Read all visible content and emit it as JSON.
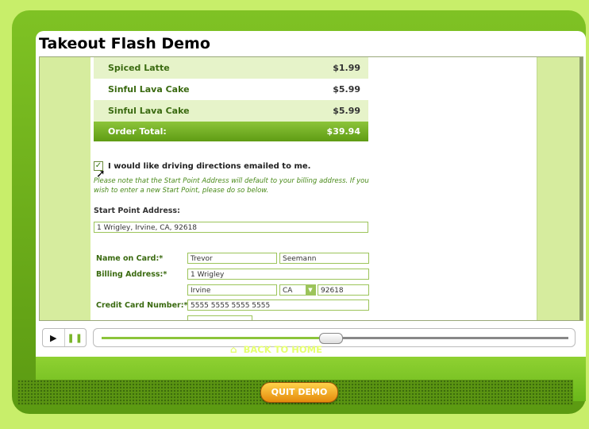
{
  "title": "Takeout Flash Demo",
  "order": {
    "rows": [
      {
        "item": "Spiced Latte",
        "price": "$1.99"
      },
      {
        "item": "Sinful Lava Cake",
        "price": "$5.99"
      },
      {
        "item": "Sinful Lava Cake",
        "price": "$5.99"
      }
    ],
    "total_label": "Order Total:",
    "total_value": "$39.94"
  },
  "directions": {
    "checkbox_label": "I would like driving directions emailed to me.",
    "checked": true,
    "note": "Please note that the Start Point Address will default to your billing address. If you wish to enter a new Start Point, please do so below."
  },
  "start_point": {
    "label": "Start Point Address:",
    "value": "1 Wrigley, Irvine, CA, 92618"
  },
  "billing": {
    "name_label": "Name on Card:*",
    "first_name": "Trevor",
    "last_name": "Seemann",
    "address_label": "Billing Address:*",
    "address": "1 Wrigley",
    "city": "Irvine",
    "state": "CA",
    "zip": "92618",
    "card_label": "Credit Card Number:*",
    "card_number": "5555 5555 5555 5555"
  },
  "player": {
    "play_icon": "play-icon",
    "pause_icon": "pause-icon",
    "progress": 0.49
  },
  "footer": {
    "back_home": "BACK TO HOME",
    "quit": "QUIT DEMO"
  },
  "colors": {
    "accent_green": "#7ab52a",
    "background": "#c8ee6a",
    "quit_orange": "#f0a020"
  }
}
